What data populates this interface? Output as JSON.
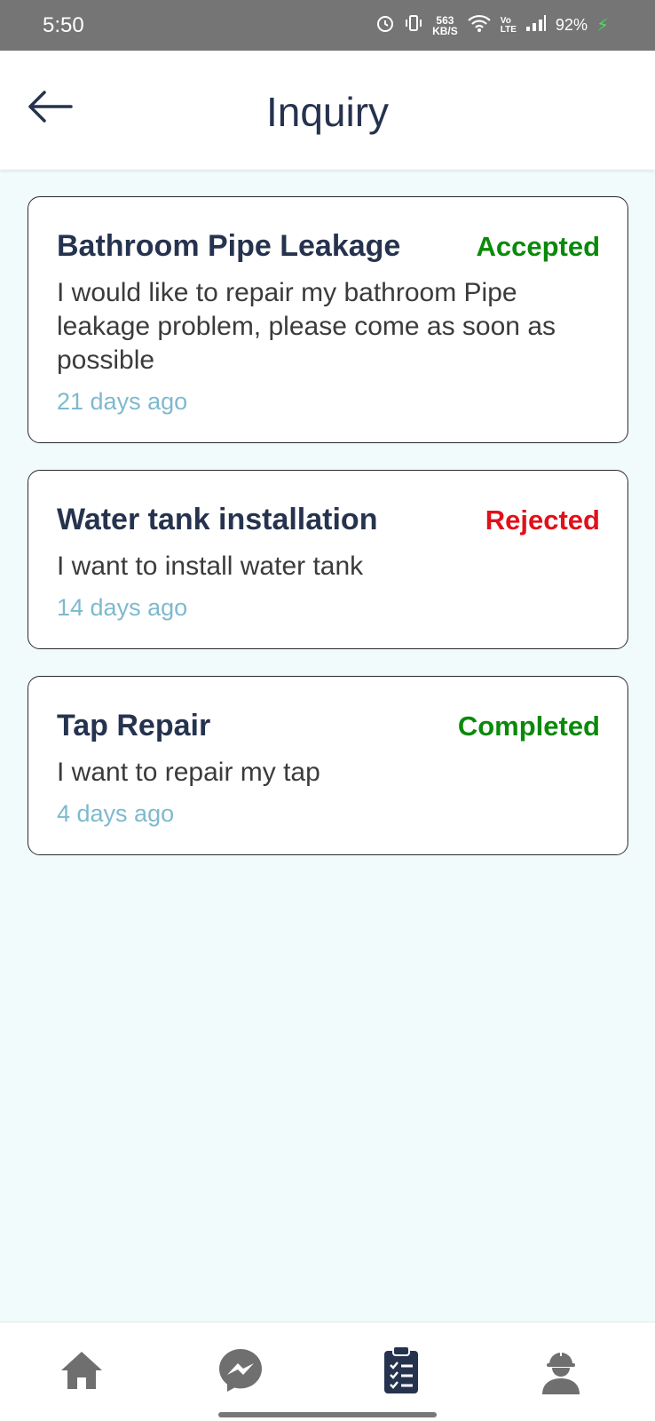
{
  "status_bar": {
    "time": "5:50",
    "net_speed_value": "563",
    "net_speed_unit": "KB/S",
    "volte_top": "Vo",
    "volte_bottom": "LTE",
    "battery": "92%"
  },
  "header": {
    "title": "Inquiry",
    "back_icon": "arrow-left-icon"
  },
  "inquiries": [
    {
      "title": "Bathroom Pipe Leakage",
      "status": "Accepted",
      "status_color": "#0a8a0a",
      "description": "I would like to repair my bathroom Pipe leakage problem, please come as soon as possible",
      "time_ago": "21 days ago"
    },
    {
      "title": "Water tank installation",
      "status": "Rejected",
      "status_color": "#e0111a",
      "description": "I want to install water tank",
      "time_ago": "14 days ago"
    },
    {
      "title": "Tap Repair",
      "status": "Completed",
      "status_color": "#0a8a0a",
      "description": "I want to repair my tap",
      "time_ago": "4 days ago"
    }
  ],
  "bottom_nav": [
    {
      "icon": "home-icon",
      "active": false
    },
    {
      "icon": "messenger-icon",
      "active": false
    },
    {
      "icon": "clipboard-list-icon",
      "active": true
    },
    {
      "icon": "worker-profile-icon",
      "active": false
    }
  ],
  "colors": {
    "primary_text": "#26334f",
    "background": "#f1fbfc",
    "time_text": "#7eb9cf",
    "nav_inactive": "#6f6f6f"
  }
}
